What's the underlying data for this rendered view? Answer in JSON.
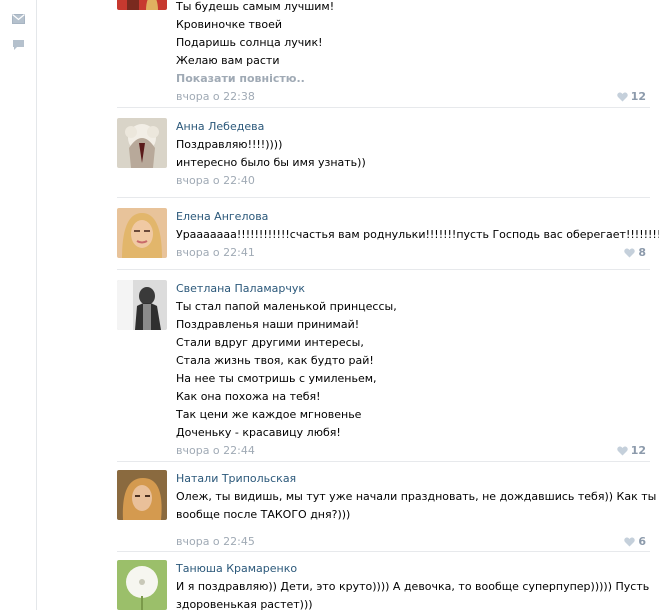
{
  "colors": {
    "author_link": "#2b587a",
    "timestamp": "#a0aab5",
    "likes": "#8c9aab",
    "separator": "#e7e9ec"
  },
  "left_icons": [
    "mail-icon",
    "comment-icon"
  ],
  "comments": [
    {
      "author": "",
      "lines": [
        "Ты будешь самым лучшим!",
        "Кровиночке твоей",
        "Подаришь солнца лучик!",
        "Желаю вам расти"
      ],
      "more_link": "Показати повністю..",
      "time": "вчора о 22:38",
      "likes": "12"
    },
    {
      "author": "Анна Лебедева",
      "lines": [
        "Поздравляю!!!!))))",
        "интересно было бы имя узнать))"
      ],
      "time": "вчора о 22:40",
      "likes": ""
    },
    {
      "author": "Елена Ангелова",
      "lines": [
        "Урааааааа!!!!!!!!!!!!счастья вам роднульки!!!!!!!пусть Господь вас оберегает!!!!!!!!!!"
      ],
      "time": "вчора о 22:41",
      "likes": "8"
    },
    {
      "author": "Светлана Паламарчук",
      "lines": [
        "Ты стал папой маленькой принцессы,",
        "Поздравленья наши принимай!",
        "Стали вдруг другими интересы,",
        "Стала жизнь твоя, как будто рай!",
        "На нее ты смотришь с умиленьем,",
        "Как она похожа на тебя!",
        "Так цени же каждое мгновенье",
        "Доченьку - красавицу любя!"
      ],
      "time": "вчора о 22:44",
      "likes": "12"
    },
    {
      "author": "Натали Трипольская",
      "lines": [
        "Олеж, ты видишь, мы тут уже начали праздновать, не дождавшись тебя)) Как ты там",
        "вообще после ТАКОГО дня?)))"
      ],
      "time": "вчора о 22:45",
      "likes": "6"
    },
    {
      "author": "Танюша Крамаренко",
      "lines": [
        "И я поздравляю)) Дети, это круто)))) А девочка, то вообще суперпупер))))) Пусть",
        "здоровенькая растет)))"
      ],
      "time": "",
      "likes": ""
    }
  ]
}
